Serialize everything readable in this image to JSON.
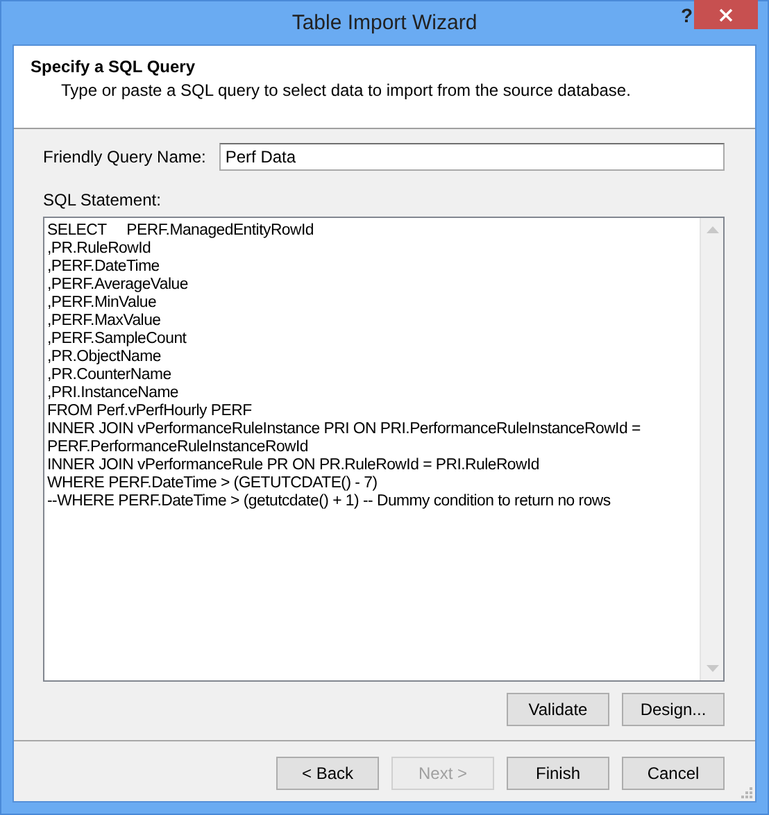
{
  "window": {
    "title": "Table Import Wizard",
    "help_button": "?"
  },
  "header": {
    "title": "Specify a SQL Query",
    "description": "Type or paste a SQL query to select data to import from the source database."
  },
  "friendly_name": {
    "label": "Friendly Query Name:",
    "value": "Perf Data"
  },
  "sql_statement": {
    "label": "SQL Statement:",
    "lines": [
      "SELECT     PERF.ManagedEntityRowId",
      ",PR.RuleRowId",
      ",PERF.DateTime",
      ",PERF.AverageValue",
      ",PERF.MinValue",
      ",PERF.MaxValue",
      ",PERF.SampleCount",
      ",PR.ObjectName",
      ",PR.CounterName",
      ",PRI.InstanceName",
      "FROM Perf.vPerfHourly PERF",
      "INNER JOIN vPerformanceRuleInstance PRI ON PRI.PerformanceRuleInstanceRowId =",
      "PERF.PerformanceRuleInstanceRowId",
      "INNER JOIN vPerformanceRule PR ON PR.RuleRowId = PRI.RuleRowId",
      "WHERE PERF.DateTime > (GETUTCDATE() - 7)",
      "--WHERE PERF.DateTime > (getutcdate() + 1) -- Dummy condition to return no rows"
    ]
  },
  "query_buttons": [
    {
      "label": "Validate",
      "disabled": false
    },
    {
      "label": "Design...",
      "disabled": false
    }
  ],
  "nav_buttons": [
    {
      "label": "< Back",
      "disabled": false
    },
    {
      "label": "Next >",
      "disabled": true
    },
    {
      "label": "Finish",
      "disabled": false
    },
    {
      "label": "Cancel",
      "disabled": false
    }
  ]
}
